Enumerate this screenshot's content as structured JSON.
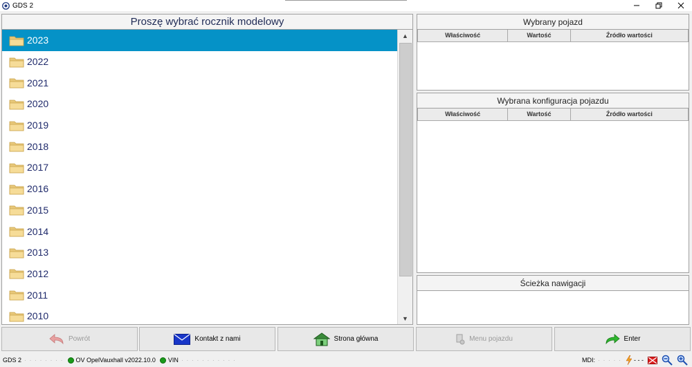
{
  "window": {
    "title": "GDS 2"
  },
  "left_panel": {
    "title": "Proszę wybrać rocznik modelowy",
    "years": [
      "2023",
      "2022",
      "2021",
      "2020",
      "2019",
      "2018",
      "2017",
      "2016",
      "2015",
      "2014",
      "2013",
      "2012",
      "2011",
      "2010"
    ],
    "selected_index": 0
  },
  "right_panel": {
    "vehicle": {
      "title": "Wybrany pojazd",
      "columns": [
        "Właściwość",
        "Wartość",
        "Źródło wartości"
      ]
    },
    "config": {
      "title": "Wybrana konfiguracja pojazdu",
      "columns": [
        "Właściwość",
        "Wartość",
        "Źródło wartości"
      ]
    },
    "nav_path": {
      "title": "Ścieżka nawigacji"
    }
  },
  "toolbar": {
    "back": "Powrót",
    "contact": "Kontakt z nami",
    "home": "Strona główna",
    "vehicle_menu": "Menu pojazdu",
    "enter": "Enter"
  },
  "statusbar": {
    "app": "GDS 2",
    "app_detail": "· · · · · · · ·",
    "module": "OV OpelVauxhall v2022.10.0",
    "vin_label": "VIN",
    "vin_value": "· · · · · · · · · · ·",
    "mdi_label": "MDI:",
    "mdi_value": "· · · · ·",
    "signal": "- - -"
  },
  "colors": {
    "selection": "#0592c7",
    "year_text": "#1f2a6b",
    "status_ok": "#1a9a1a"
  }
}
